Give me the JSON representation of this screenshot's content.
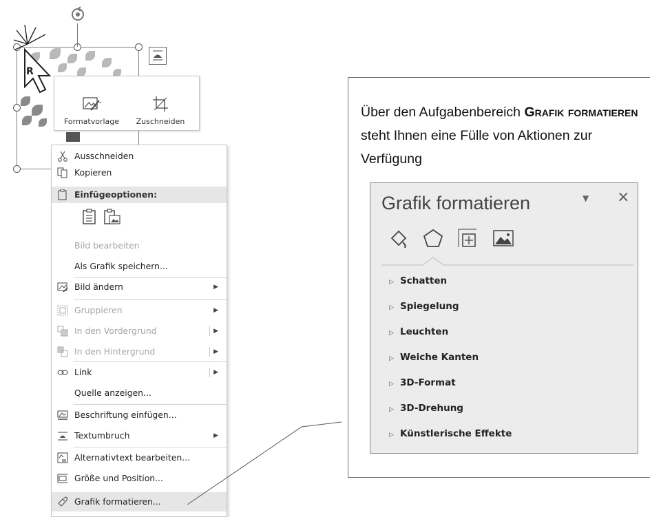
{
  "picture": {
    "rotate_handle_icon": "rotate-handle-icon",
    "cursor_label": "R",
    "layout_options_icon": "layout-options-icon"
  },
  "minibar": {
    "style_label": "Formatvorlage",
    "crop_label": "Zuschneiden"
  },
  "menu": {
    "items": [
      {
        "label": "Ausschneiden",
        "icon": "scissors-icon"
      },
      {
        "label": "Kopieren",
        "icon": "copy-icon"
      },
      {
        "label": "Einfügeoptionen:",
        "icon": "paste-icon"
      },
      {
        "label": "Bild bearbeiten",
        "icon": ""
      },
      {
        "label": "Als Grafik speichern...",
        "icon": ""
      },
      {
        "label": "Bild ändern",
        "icon": "change-picture-icon"
      },
      {
        "label": "Gruppieren",
        "icon": "group-icon"
      },
      {
        "label": "In den Vordergrund",
        "icon": "bring-forward-icon"
      },
      {
        "label": "In den Hintergrund",
        "icon": "send-backward-icon"
      },
      {
        "label": "Link",
        "icon": "link-icon"
      },
      {
        "label": "Quelle anzeigen...",
        "icon": ""
      },
      {
        "label": "Beschriftung einfügen...",
        "icon": "caption-icon"
      },
      {
        "label": "Textumbruch",
        "icon": "wrap-text-icon"
      },
      {
        "label": "Alternativtext bearbeiten...",
        "icon": "alt-text-icon"
      },
      {
        "label": "Größe und Position...",
        "icon": "size-position-icon"
      },
      {
        "label": "Grafik formatieren...",
        "icon": "format-picture-icon"
      }
    ]
  },
  "callout": {
    "text_1": "Über den Aufgabenbereich",
    "text_sc_1": "Grafik",
    "text_sc_2": "formatieren",
    "text_2": "steht Ihnen eine Fülle",
    "text_3": "von Aktionen zur Verfügung"
  },
  "pane": {
    "title": "Grafik formatieren",
    "close_glyph": "×",
    "dropdown_glyph": "▼",
    "sections": [
      "Schatten",
      "Spiegelung",
      "Leuchten",
      "Weiche Kanten",
      "3D-Format",
      "3D-Drehung",
      "Künstlerische Effekte"
    ]
  },
  "colors": {
    "menu_highlight": "#e6e6e6",
    "pane_background": "#ececec",
    "disabled_text": "#a6a6a6"
  }
}
